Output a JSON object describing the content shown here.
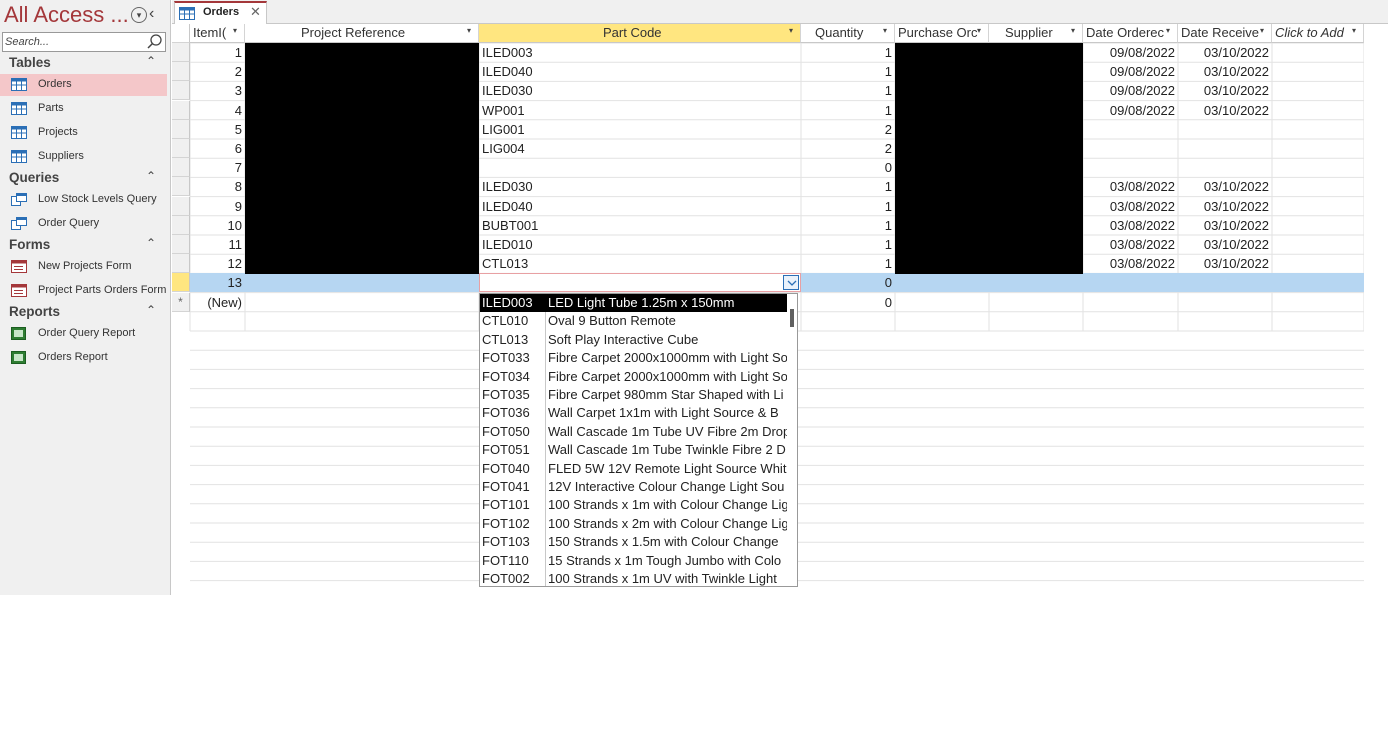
{
  "nav": {
    "title": "All Access ...",
    "search_placeholder": "Search...",
    "groups": [
      {
        "label": "Tables",
        "items": [
          "Orders",
          "Parts",
          "Projects",
          "Suppliers"
        ]
      },
      {
        "label": "Queries",
        "items": [
          "Low Stock Levels Query",
          "Order Query"
        ]
      },
      {
        "label": "Forms",
        "items": [
          "New Projects Form",
          "Project Parts Orders Form"
        ]
      },
      {
        "label": "Reports",
        "items": [
          "Order Query Report",
          "Orders Report"
        ]
      }
    ],
    "selected_item": "Orders"
  },
  "tab": {
    "label": "Orders"
  },
  "columns": [
    "ItemI(",
    "Project Reference",
    "Part Code",
    "Quantity",
    "Purchase Orc",
    "Supplier",
    "Date Orderec",
    "Date Receive",
    "Click to Add"
  ],
  "rows": [
    {
      "id": "1",
      "part": "ILED003",
      "qty": "1",
      "ordered": "09/08/2022",
      "received": "03/10/2022"
    },
    {
      "id": "2",
      "part": "ILED040",
      "qty": "1",
      "ordered": "09/08/2022",
      "received": "03/10/2022"
    },
    {
      "id": "3",
      "part": "ILED030",
      "qty": "1",
      "ordered": "09/08/2022",
      "received": "03/10/2022"
    },
    {
      "id": "4",
      "part": "WP001",
      "qty": "1",
      "ordered": "09/08/2022",
      "received": "03/10/2022"
    },
    {
      "id": "5",
      "part": "LIG001",
      "qty": "2",
      "ordered": "",
      "received": ""
    },
    {
      "id": "6",
      "part": "LIG004",
      "qty": "2",
      "ordered": "",
      "received": ""
    },
    {
      "id": "7",
      "part": "",
      "qty": "0",
      "ordered": "",
      "received": ""
    },
    {
      "id": "8",
      "part": "ILED030",
      "qty": "1",
      "ordered": "03/08/2022",
      "received": "03/10/2022"
    },
    {
      "id": "9",
      "part": "ILED040",
      "qty": "1",
      "ordered": "03/08/2022",
      "received": "03/10/2022"
    },
    {
      "id": "10",
      "part": "BUBT001",
      "qty": "1",
      "ordered": "03/08/2022",
      "received": "03/10/2022"
    },
    {
      "id": "11",
      "part": "ILED010",
      "qty": "1",
      "ordered": "03/08/2022",
      "received": "03/10/2022"
    },
    {
      "id": "12",
      "part": "CTL013",
      "qty": "1",
      "ordered": "03/08/2022",
      "received": "03/10/2022"
    },
    {
      "id": "13",
      "part": "",
      "qty": "0",
      "ordered": "",
      "received": ""
    }
  ],
  "new_row": {
    "marker": "*",
    "id": "(New)",
    "qty": "0"
  },
  "dropdown": [
    {
      "code": "ILED003",
      "desc": "LED Light Tube 1.25m x 150mm"
    },
    {
      "code": "CTL010",
      "desc": "Oval 9 Button Remote"
    },
    {
      "code": "CTL013",
      "desc": "Soft Play Interactive Cube"
    },
    {
      "code": "FOT033",
      "desc": "Fibre Carpet 2000x1000mm with Light So"
    },
    {
      "code": "FOT034",
      "desc": "Fibre Carpet 2000x1000mm with Light So"
    },
    {
      "code": "FOT035",
      "desc": "Fibre Carpet 980mm Star Shaped with Li"
    },
    {
      "code": "FOT036",
      "desc": "Wall Carpet 1x1m with Light Source & B"
    },
    {
      "code": "FOT050",
      "desc": "Wall Cascade 1m Tube UV Fibre 2m Drop"
    },
    {
      "code": "FOT051",
      "desc": "Wall Cascade 1m Tube Twinkle Fibre 2 D"
    },
    {
      "code": "FOT040",
      "desc": "FLED 5W 12V Remote Light Source Whit"
    },
    {
      "code": "FOT041",
      "desc": "12V Interactive Colour Change Light Sou"
    },
    {
      "code": "FOT101",
      "desc": "100 Strands x 1m with Colour Change Lig"
    },
    {
      "code": "FOT102",
      "desc": "100 Strands x 2m with Colour Change Lig"
    },
    {
      "code": "FOT103",
      "desc": "150 Strands x 1.5m with Colour Change"
    },
    {
      "code": "FOT110",
      "desc": "15 Strands x 1m Tough Jumbo with Colo"
    },
    {
      "code": "FOT002",
      "desc": "100 Strands x 1m UV with Twinkle Light"
    }
  ],
  "colors": {
    "accent": "#a4373a",
    "selected_nav": "#f4c7c9",
    "active_row": "#b6d6f2",
    "header_highlight": "#ffe680"
  }
}
